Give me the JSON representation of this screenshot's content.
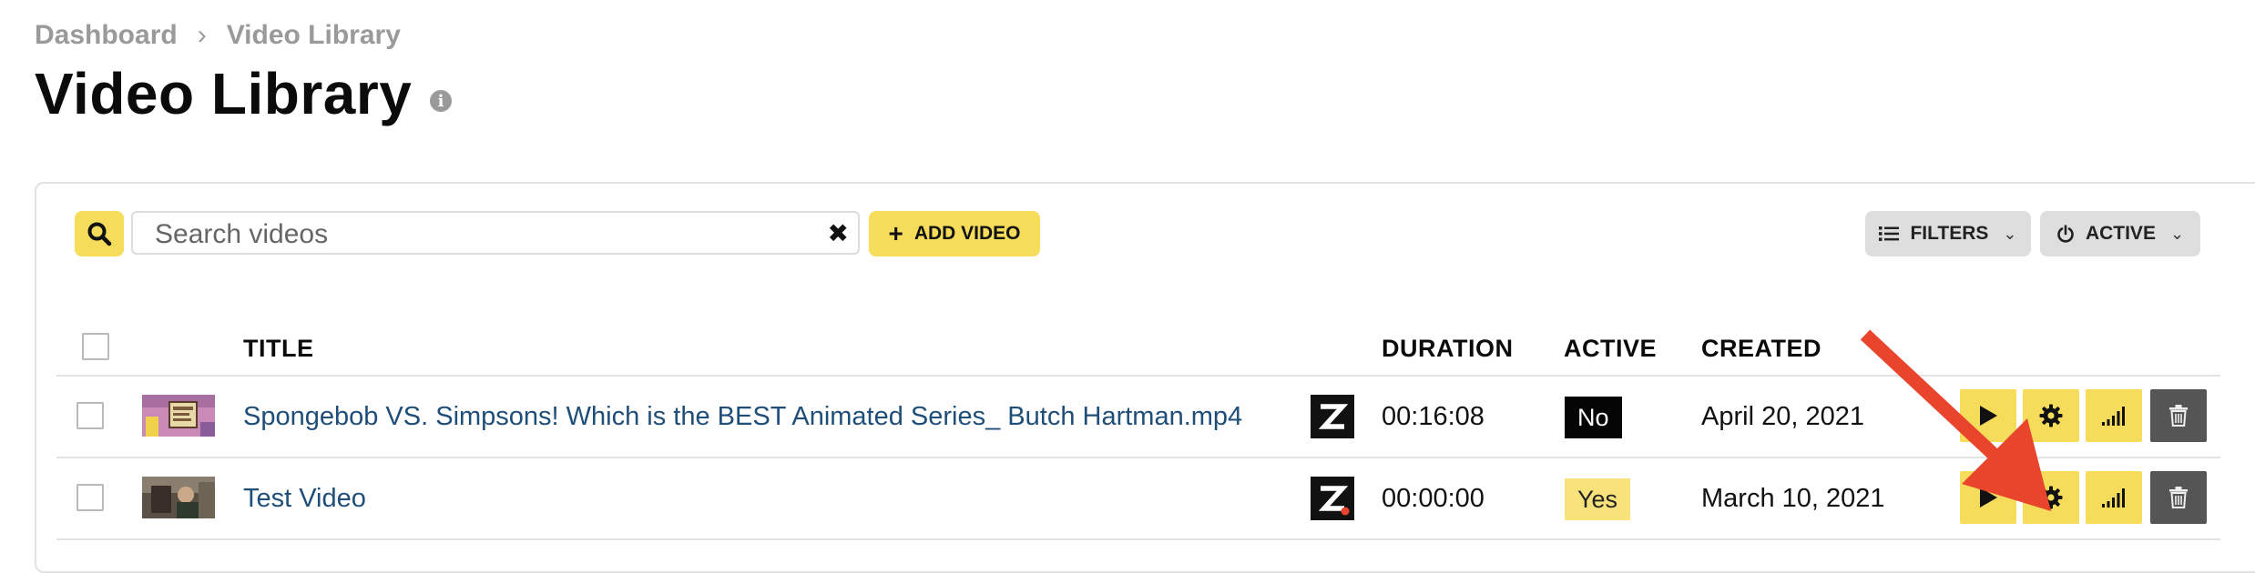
{
  "breadcrumb": {
    "items": [
      "Dashboard",
      "Video Library"
    ],
    "separator": "›"
  },
  "page": {
    "title": "Video Library",
    "info_icon": "i"
  },
  "toolbar": {
    "search_placeholder": "Search videos",
    "search_value": "",
    "add_video_label": "ADD VIDEO",
    "filters_label": "FILTERS",
    "active_label": "ACTIVE"
  },
  "table": {
    "headers": {
      "title": "TITLE",
      "duration": "DURATION",
      "active": "ACTIVE",
      "created": "CREATED"
    },
    "rows": [
      {
        "title": "Spongebob VS. Simpsons! Which is the BEST Animated Series_ Butch Hartman.mp4",
        "duration": "00:16:08",
        "active": "No",
        "created": "April 20, 2021"
      },
      {
        "title": "Test Video",
        "duration": "00:00:00",
        "active": "Yes",
        "created": "March 10, 2021"
      }
    ]
  },
  "colors": {
    "accent_yellow": "#f5dc5a",
    "pill_gray": "#dedede",
    "link_blue": "#1f4e79",
    "arrow_red": "#e8452c",
    "delete_gray": "#555555"
  },
  "icons": [
    "search-icon",
    "clear-icon",
    "plus-icon",
    "list-icon",
    "power-icon",
    "chevron-down-icon",
    "play-icon",
    "gear-icon",
    "signal-icon",
    "trash-icon",
    "info-icon",
    "z-logo-icon"
  ]
}
